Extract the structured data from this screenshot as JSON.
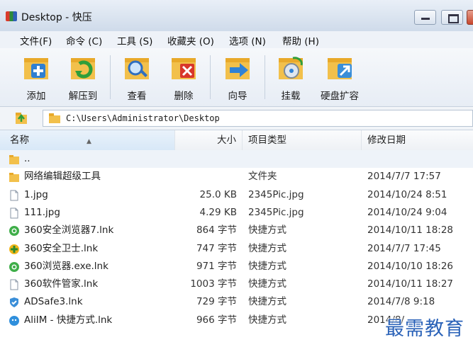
{
  "window": {
    "title": "Desktop - 快压"
  },
  "menu": [
    "文件(F)",
    "命令 (C)",
    "工具 (S)",
    "收藏夹 (O)",
    "选项 (N)",
    "帮助 (H)"
  ],
  "toolbar": [
    "添加",
    "解压到",
    "查看",
    "删除",
    "向导",
    "挂载",
    "硬盘扩容"
  ],
  "address": {
    "path": "C:\\Users\\Administrator\\Desktop"
  },
  "columns": {
    "name": "名称",
    "size": "大小",
    "type": "项目类型",
    "date": "修改日期"
  },
  "files": [
    {
      "name": "..",
      "size": "",
      "type": "",
      "date": "",
      "icon": "folder-up-icon"
    },
    {
      "name": "网络编辑超级工具",
      "size": "",
      "type": "文件夹",
      "date": "2014/7/7 17:57",
      "icon": "folder-icon"
    },
    {
      "name": "1.jpg",
      "size": "25.0 KB",
      "type": "2345Pic.jpg",
      "date": "2014/10/24 8:51",
      "icon": "file-icon"
    },
    {
      "name": "111.jpg",
      "size": "4.29 KB",
      "type": "2345Pic.jpg",
      "date": "2014/10/24 9:04",
      "icon": "file-icon"
    },
    {
      "name": "360安全浏览器7.lnk",
      "size": "864 字节",
      "type": "快捷方式",
      "date": "2014/10/11 18:28",
      "icon": "browser-360-icon"
    },
    {
      "name": "360安全卫士.lnk",
      "size": "747 字节",
      "type": "快捷方式",
      "date": "2014/7/7 17:45",
      "icon": "guard-360-icon"
    },
    {
      "name": "360浏览器.exe.lnk",
      "size": "971 字节",
      "type": "快捷方式",
      "date": "2014/10/10 18:26",
      "icon": "browser-360-icon"
    },
    {
      "name": "360软件管家.lnk",
      "size": "1003 字节",
      "type": "快捷方式",
      "date": "2014/10/11 18:27",
      "icon": "file-icon"
    },
    {
      "name": "ADSafe3.lnk",
      "size": "729 字节",
      "type": "快捷方式",
      "date": "2014/7/8 9:18",
      "icon": "adsafe-icon"
    },
    {
      "name": "AliIM - 快捷方式.lnk",
      "size": "966 字节",
      "type": "快捷方式",
      "date": "2014/8/",
      "icon": "aliim-icon"
    }
  ],
  "watermark": "最需教育"
}
